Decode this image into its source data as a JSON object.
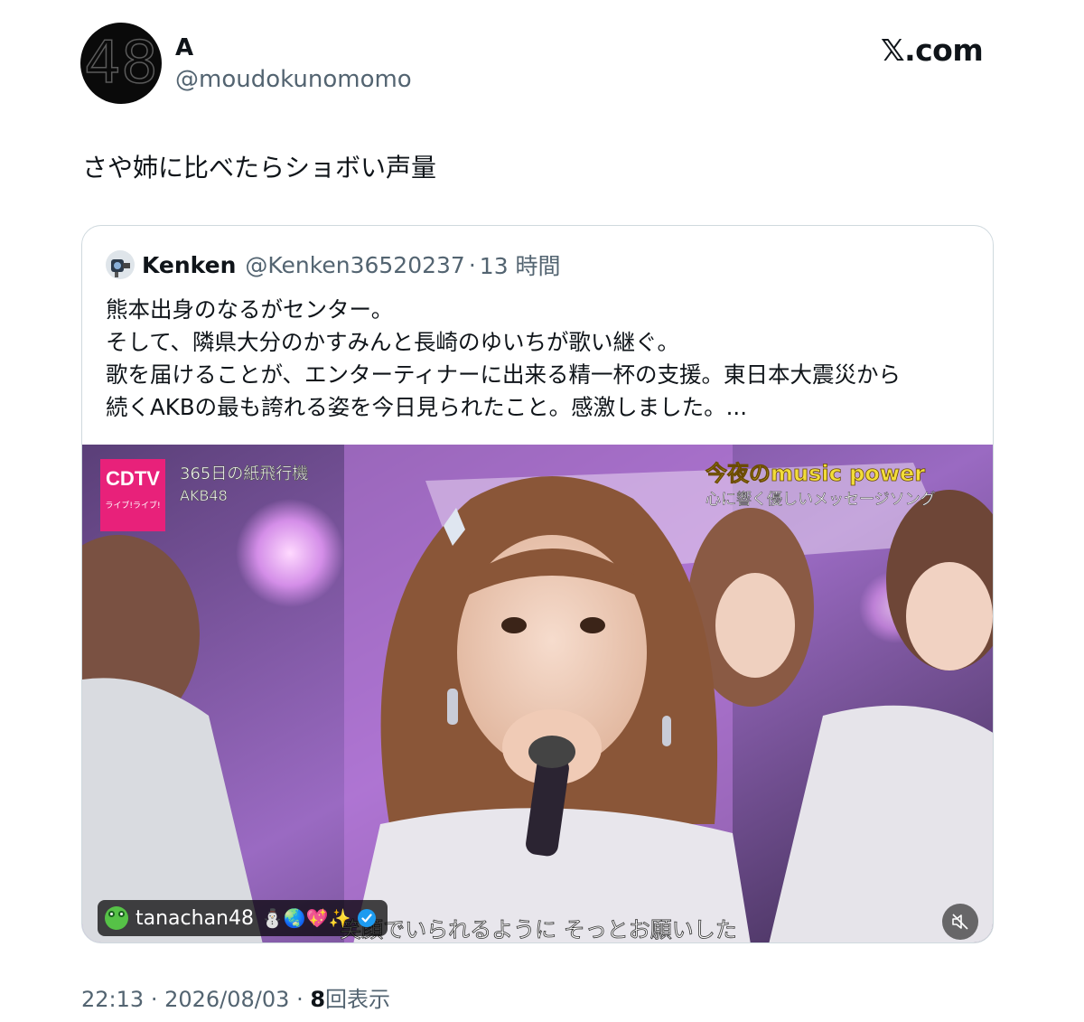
{
  "author": {
    "display_name": "A",
    "handle": "@moudokunomomo",
    "avatar_text": "48"
  },
  "brand": {
    "label": "𝕏.com",
    "icon": "x-logo-icon"
  },
  "tweet": {
    "text": "さや姉に比べたらショボい声量"
  },
  "quoted": {
    "display_name": "Kenken",
    "handle": "@Kenken36520237",
    "separator": "·",
    "time": "13 時間",
    "lines": [
      "熊本出身のなるがセンター。",
      "そして、隣県大分のかすみんと長崎のゆいちが歌い継ぐ。",
      "歌を届けることが、エンターティナーに出来る精一杯の支援。東日本大震災から",
      "続くAKBの最も誇れる姿を今日見られたこと。感激しました。..."
    ]
  },
  "media": {
    "overlay": {
      "logo_top": "CDTV",
      "logo_bottom": "ライブ!ライブ!",
      "song_title": "365日の紙飛行機",
      "artist": "AKB48",
      "corner_title": "今夜のmusic power",
      "corner_subtitle": "心に響く優しいメッセージソング",
      "subtitle": "笑顔でいられるように そっとお願いした"
    },
    "channel_tag": {
      "name": "tanachan48",
      "emojis": "⛄🌏💖✨"
    },
    "mute_icon": "muted-speaker-icon"
  },
  "footer": {
    "time": "22:13",
    "dot": "·",
    "date": "2026/08/03",
    "views_count": "8",
    "views_label": "回表示"
  },
  "colors": {
    "text": "#0f1419",
    "secondary": "#536471",
    "border": "#cfd9de",
    "cdtv_pink": "#e8217a"
  }
}
